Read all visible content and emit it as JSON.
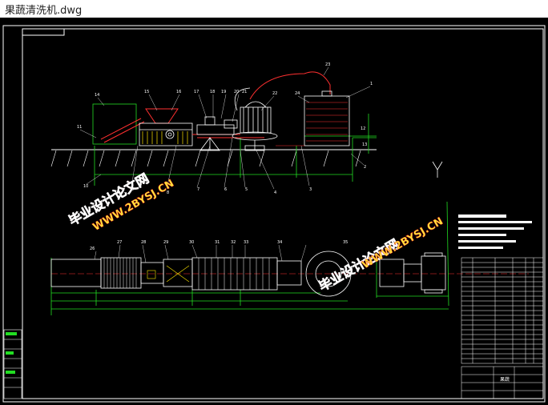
{
  "window": {
    "title": "果蔬清洗机.dwg"
  },
  "drawing": {
    "frame_label": "",
    "watermarks": {
      "cn_1": "毕业设计论文网",
      "url_1": "WWW.2BYSJ.CN",
      "cn_2": "毕业设计论文网",
      "url_2": "WWW.2BYSJ.CN"
    },
    "part_numbers_top": [
      "14",
      "15",
      "16",
      "17",
      "18",
      "19",
      "20",
      "21",
      "22",
      "23",
      "24",
      "1",
      "2",
      "3",
      "4",
      "5",
      "6",
      "7",
      "8",
      "9",
      "10",
      "11",
      "12",
      "13"
    ],
    "part_numbers_bottom": [
      "26",
      "27",
      "28",
      "29",
      "30",
      "31",
      "32",
      "33",
      "34",
      "35"
    ],
    "title_block_name": "果蔬"
  },
  "colors": {
    "background": "#000000",
    "outline": "#ffffff",
    "green": "#22dd22",
    "red": "#ff3030",
    "yellow": "#ffe600",
    "cyan": "#00e0e0",
    "magenta": "#ff40ff",
    "watermark": "#ff2020",
    "watermark_url": "#ffeb3b"
  }
}
